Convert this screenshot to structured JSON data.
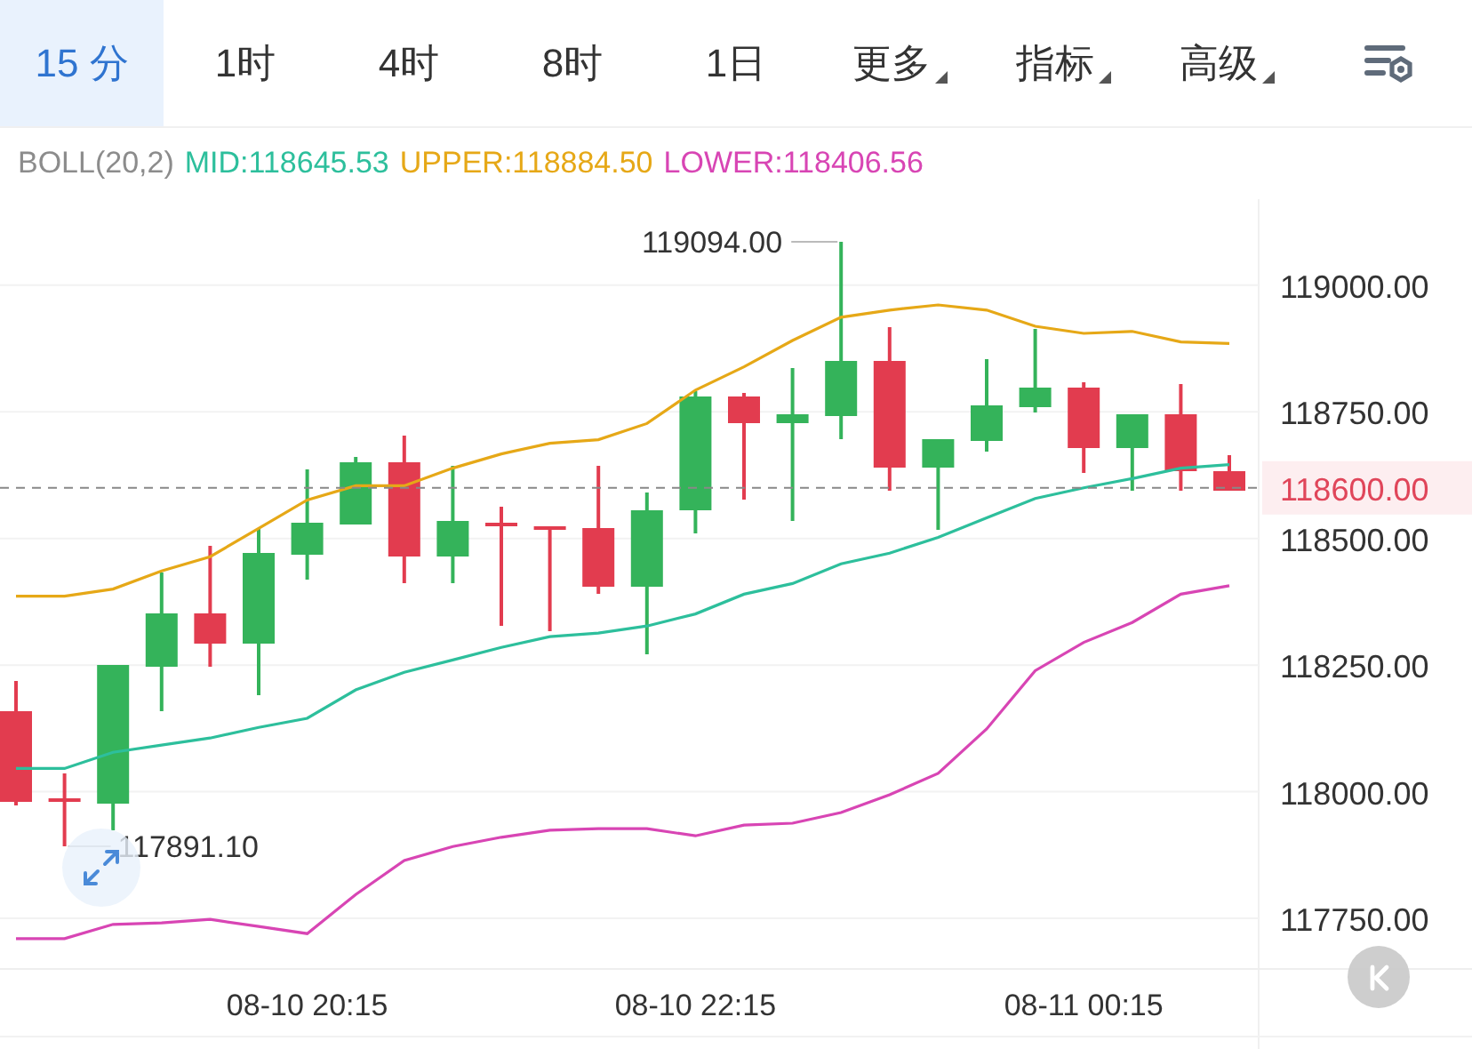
{
  "tabs": [
    {
      "label": "15 分",
      "selected": true,
      "dropdown": false
    },
    {
      "label": "1时",
      "selected": false,
      "dropdown": false
    },
    {
      "label": "4时",
      "selected": false,
      "dropdown": false
    },
    {
      "label": "8时",
      "selected": false,
      "dropdown": false
    },
    {
      "label": "1日",
      "selected": false,
      "dropdown": false
    },
    {
      "label": "更多",
      "selected": false,
      "dropdown": true
    },
    {
      "label": "指标",
      "selected": false,
      "dropdown": true
    },
    {
      "label": "高级",
      "selected": false,
      "dropdown": true
    }
  ],
  "chart": {
    "chart_data": {
      "type": "line",
      "title": "BOLL(20,2)",
      "categories": [
        null,
        null,
        null,
        null,
        null,
        null,
        "08-10 20:15",
        null,
        null,
        null,
        null,
        null,
        null,
        null,
        "08-10 22:15",
        null,
        null,
        null,
        null,
        null,
        null,
        null,
        "08-11 00:15",
        null,
        null,
        null
      ],
      "series": [
        {
          "name": "MID:118645.53",
          "color": "#2dbf9c",
          "values": [
            118046,
            118046,
            118078,
            118092,
            118106,
            118127,
            118145,
            118201,
            118236,
            118260,
            118285,
            118306,
            118313,
            118327,
            118351,
            118390,
            118411,
            118450,
            118471,
            118502,
            118541,
            118579,
            118600,
            118618,
            118639,
            118646
          ]
        },
        {
          "name": "UPPER:118884.50",
          "color": "#e6a817",
          "values": [
            118386,
            118386,
            118400,
            118436,
            118464,
            118520,
            118576,
            118604,
            118604,
            118639,
            118667,
            118688,
            118695,
            118727,
            118793,
            118839,
            118891,
            118937,
            118951,
            118961,
            118951,
            118919,
            118905,
            118909,
            118888,
            118885
          ]
        },
        {
          "name": "LOWER:118406.56",
          "color": "#d845b4",
          "values": [
            117710,
            117710,
            117738,
            117741,
            117748,
            117734,
            117720,
            117797,
            117864,
            117892,
            117910,
            117924,
            117927,
            117927,
            117913,
            117934,
            117938,
            117959,
            117994,
            118036,
            118124,
            118239,
            118295,
            118334,
            118390,
            118407
          ]
        }
      ],
      "ylim": [
        117650,
        119170
      ],
      "yticks": [
        {
          "value": 119000,
          "label": "119000.00"
        },
        {
          "value": 118750,
          "label": "118750.00"
        },
        {
          "value": 118500,
          "label": "118500.00"
        },
        {
          "value": 118250,
          "label": "118250.00"
        },
        {
          "value": 118000,
          "label": "118000.00"
        },
        {
          "value": 117750,
          "label": "117750.00"
        }
      ],
      "grid": true,
      "ref_lines": [
        {
          "axis": "y",
          "value": 118600,
          "label": "118600.00",
          "color": "#888888"
        }
      ],
      "annotations": [
        "119094.00",
        "117891.10"
      ]
    }
  }
}
